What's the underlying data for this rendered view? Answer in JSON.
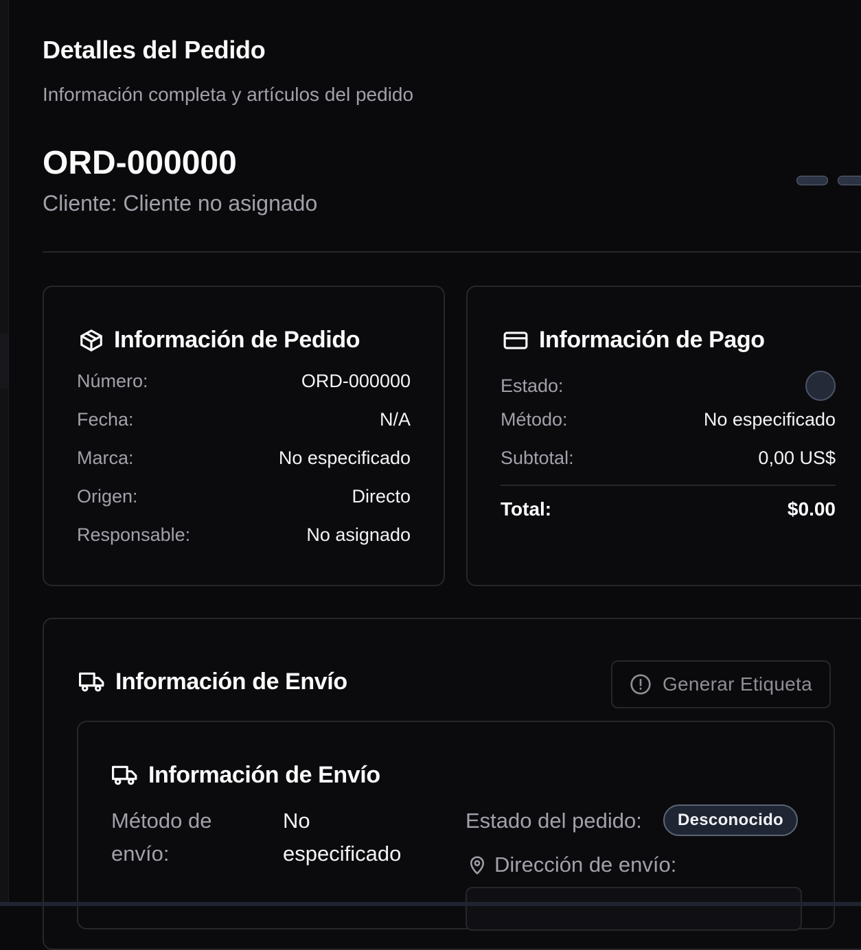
{
  "modal": {
    "title": "Detalles del Pedido",
    "subtitle": "Información completa y artículos del pedido"
  },
  "order": {
    "number": "ORD-000000",
    "client_line": "Cliente: Cliente no asignado"
  },
  "order_info": {
    "title": "Información de Pedido",
    "icon": "package-icon",
    "rows": [
      {
        "label": "Número:",
        "value": "ORD-000000"
      },
      {
        "label": "Fecha:",
        "value": "N/A"
      },
      {
        "label": "Marca:",
        "value": "No especificado"
      },
      {
        "label": "Origen:",
        "value": "Directo"
      },
      {
        "label": "Responsable:",
        "value": "No asignado"
      }
    ]
  },
  "payment_info": {
    "title": "Información de Pago",
    "icon": "credit-card-icon",
    "status_label": "Estado:",
    "method_label": "Método:",
    "method_value": "No especificado",
    "subtotal_label": "Subtotal:",
    "subtotal_value": "0,00 US$",
    "total_label": "Total:",
    "total_value": "$0.00"
  },
  "shipping": {
    "title": "Información de Envío",
    "icon": "truck-icon",
    "generate_label_button": "Generar Etiqueta",
    "generate_label_icon": "alert-circle-icon",
    "inner": {
      "title": "Información de Envío",
      "method_label_line1": "Método de",
      "method_label_line2": "envío:",
      "method_value_line1": "No",
      "method_value_line2": "especificado",
      "order_status_label": "Estado del pedido:",
      "order_status_badge": "Desconocido",
      "address_label": "Dirección de envío:",
      "address_icon": "map-pin-icon"
    }
  },
  "colors": {
    "background": "#0a0a0c",
    "border": "#27272a",
    "muted_text": "#a1a1aa",
    "badge_bg": "#1f2533"
  }
}
